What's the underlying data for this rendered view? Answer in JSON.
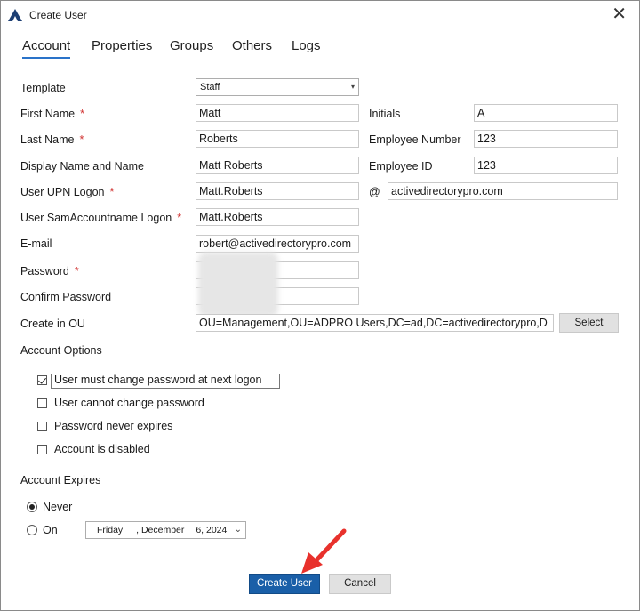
{
  "window": {
    "title": "Create User",
    "close_glyph": "✕"
  },
  "tabs": [
    "Account",
    "Properties",
    "Groups",
    "Others",
    "Logs"
  ],
  "form": {
    "template": {
      "label": "Template",
      "value": "Staff"
    },
    "first_name": {
      "label": "First Name",
      "value": "Matt"
    },
    "last_name": {
      "label": "Last Name",
      "value": "Roberts"
    },
    "display_name": {
      "label": "Display Name and Name",
      "value": "Matt Roberts"
    },
    "upn": {
      "label": "User UPN Logon",
      "value": "Matt.Roberts",
      "at": "@",
      "domain": "activedirectorypro.com"
    },
    "sam": {
      "label": "User SamAccountname Logon",
      "value": "Matt.Roberts"
    },
    "email": {
      "label": "E-mail",
      "value": "robert@activedirectorypro.com"
    },
    "password": {
      "label": "Password"
    },
    "confirm_password": {
      "label": "Confirm Password"
    },
    "ou": {
      "label": "Create in OU",
      "value": "OU=Management,OU=ADPRO Users,DC=ad,DC=activedirectorypro,D",
      "select_label": "Select"
    },
    "initials": {
      "label": "Initials",
      "value": "A"
    },
    "employee_number": {
      "label": "Employee Number",
      "value": "123"
    },
    "employee_id": {
      "label": "Employee ID",
      "value": "123"
    },
    "required_mark": "*"
  },
  "account_options": {
    "heading": "Account Options",
    "items": [
      {
        "label": "User must change password at next logon",
        "checked": true
      },
      {
        "label": "User cannot change password",
        "checked": false
      },
      {
        "label": "Password never expires",
        "checked": false
      },
      {
        "label": "Account is disabled",
        "checked": false
      }
    ]
  },
  "account_expires": {
    "heading": "Account Expires",
    "never_label": "Never",
    "on_label": "On",
    "selected": "Never",
    "date": {
      "weekday": "Friday",
      "month": "December",
      "day": "6,",
      "year": "2024",
      "sep": ","
    }
  },
  "buttons": {
    "create": "Create User",
    "cancel": "Cancel"
  },
  "colors": {
    "accent": "#2a73c9",
    "primary_button": "#1a5fa8",
    "required": "#d0302f",
    "annotation_arrow": "#e8312c"
  }
}
